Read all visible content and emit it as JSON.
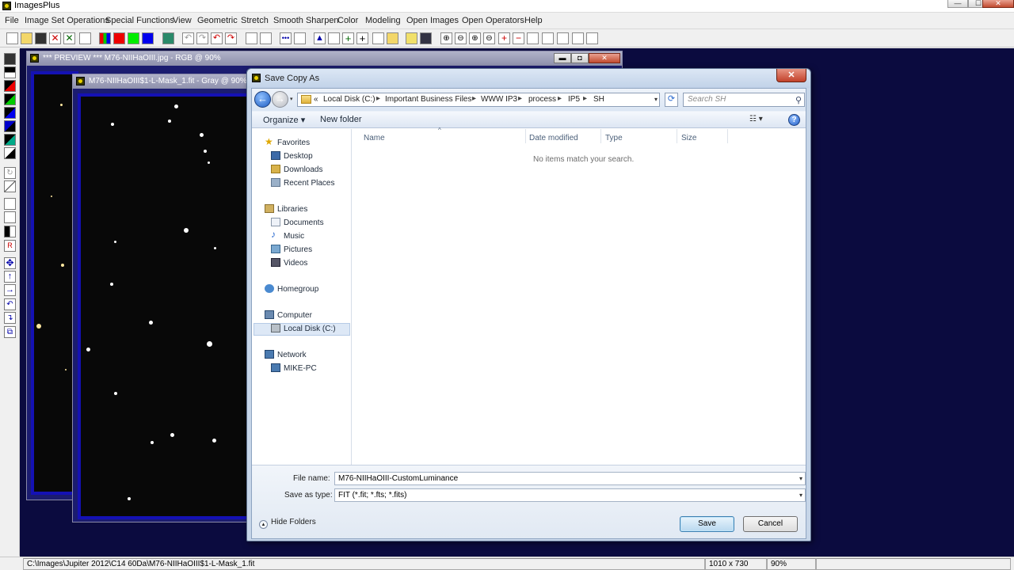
{
  "app": {
    "title": "ImagesPlus",
    "win_min": "—",
    "win_max": "☐",
    "win_close": "✕"
  },
  "menubar": {
    "items": [
      "File",
      "Image Set Operations",
      "Special Functions",
      "View",
      "Geometric",
      "Stretch",
      "Smooth Sharpen",
      "Color",
      "Modeling",
      "Open Images",
      "Open Operators",
      "Help"
    ]
  },
  "windows": {
    "preview": {
      "title": "*** PREVIEW *** M76-NIIHaOIII.jpg - RGB @ 90%",
      "min": "▬",
      "max": "◘",
      "close": "✕"
    },
    "mask": {
      "title": "M76-NIIHaOIII$1-L-Mask_1.fit - Gray @ 90%"
    }
  },
  "dialog": {
    "title": "Save Copy As",
    "close": "✕",
    "nav": {
      "back": "←",
      "forward": "→",
      "history": "▾",
      "path": [
        "«",
        "Local Disk (C:)",
        "Important Business Files",
        "WWW IP3",
        "process",
        "IP5",
        "SH"
      ],
      "path_sep": "▸",
      "dropdown": "▾",
      "refresh": "⟳",
      "search_placeholder": "Search SH",
      "search_icon": "⚲"
    },
    "commands": {
      "organize": "Organize ▾",
      "new_folder": "New folder",
      "view": "☷ ▾",
      "help": "?"
    },
    "nav_pane": {
      "favorites": "Favorites",
      "desktop": "Desktop",
      "downloads": "Downloads",
      "recent": "Recent Places",
      "libraries": "Libraries",
      "documents": "Documents",
      "music": "Music",
      "pictures": "Pictures",
      "videos": "Videos",
      "homegroup": "Homegroup",
      "computer": "Computer",
      "local_disk": "Local Disk (C:)",
      "network": "Network",
      "mike_pc": "MIKE-PC"
    },
    "columns": {
      "name": "Name",
      "sort_arrow": "^",
      "date_modified": "Date modified",
      "type": "Type",
      "size": "Size"
    },
    "empty_message": "No items match your search.",
    "file_name_label": "File name:",
    "file_name_value": "M76-NIIHaOIII-CustomLuminance",
    "save_type_label": "Save as type:",
    "save_type_value": "FIT (*.fit; *.fts; *.fits)",
    "dropdown": "▾",
    "hide_folders": "Hide Folders",
    "hide_arrow": "▲",
    "save": "Save",
    "cancel": "Cancel"
  },
  "status": {
    "path": "C:\\Images\\Jupiter 2012\\C14 60Da\\M76-NIIHaOIII$1-L-Mask_1.fit",
    "dims": "1010 x 730",
    "zoom": "90%"
  },
  "colors": {
    "workspace": "#0b0b3f",
    "image_border": "#1411b4",
    "save_button": "#b8d8ef"
  }
}
